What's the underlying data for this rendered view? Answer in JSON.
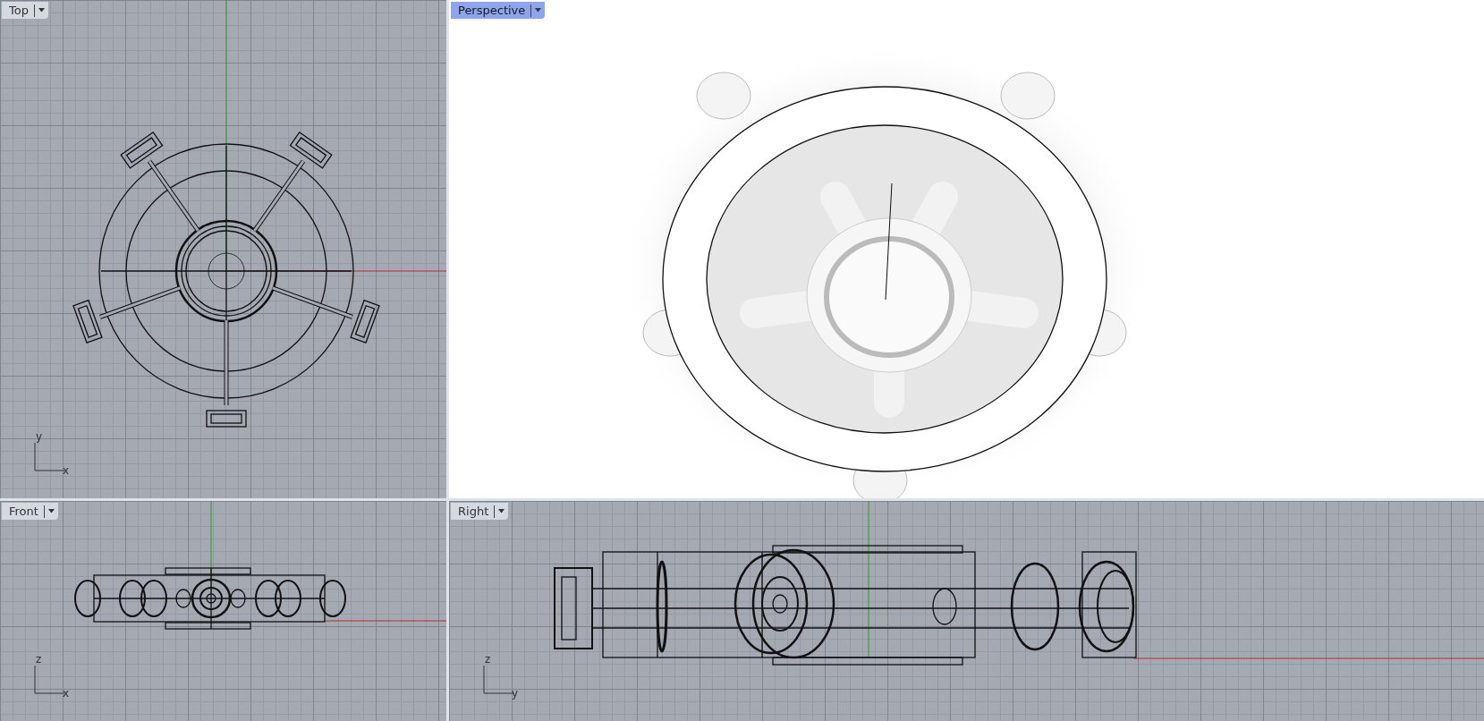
{
  "viewports": [
    {
      "title": "Top",
      "selected": false,
      "kind": "plan",
      "axes": [
        "y",
        "x"
      ]
    },
    {
      "title": "Perspective",
      "selected": true,
      "kind": "rendered"
    },
    {
      "title": "Front",
      "selected": false,
      "kind": "front",
      "axes": [
        "z",
        "x"
      ]
    },
    {
      "title": "Right",
      "selected": false,
      "kind": "side",
      "axes": [
        "z",
        "y"
      ]
    }
  ]
}
